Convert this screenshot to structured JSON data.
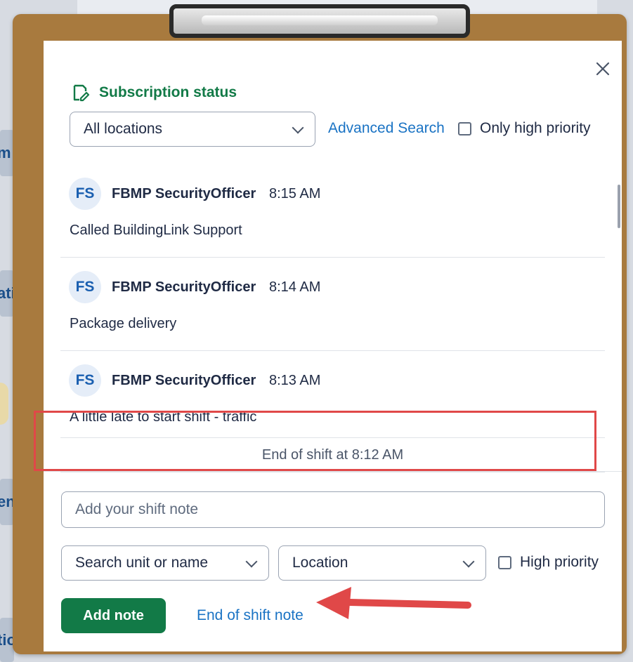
{
  "background": {
    "tab_fragments": [
      "m",
      "ati",
      "en",
      "tio"
    ]
  },
  "dialog": {
    "close_icon": "close-icon",
    "subscription_status": "Subscription status",
    "location_filter": {
      "selected": "All locations"
    },
    "advanced_search": "Advanced Search",
    "only_high_priority_label": "Only high priority",
    "notes": [
      {
        "initials": "FS",
        "author": "FBMP SecurityOfficer",
        "time": "8:15 AM",
        "text": "Called BuildingLink Support"
      },
      {
        "initials": "FS",
        "author": "FBMP SecurityOfficer",
        "time": "8:14 AM",
        "text": "Package delivery"
      },
      {
        "initials": "FS",
        "author": "FBMP SecurityOfficer",
        "time": "8:13 AM",
        "text": "A little late to start shift - traffic"
      }
    ],
    "end_of_shift_marker": "End of shift at 8:12 AM",
    "compose": {
      "note_placeholder": "Add your shift note",
      "unit_select": "Search unit or name",
      "location_select": "Location",
      "high_priority_label": "High priority",
      "add_note_button": "Add note",
      "end_of_shift_link": "End of shift note"
    }
  },
  "colors": {
    "clipboard": "#a87a3e",
    "brand_green": "#127a47",
    "link_blue": "#1a73c4",
    "annotation_red": "#e04848"
  }
}
